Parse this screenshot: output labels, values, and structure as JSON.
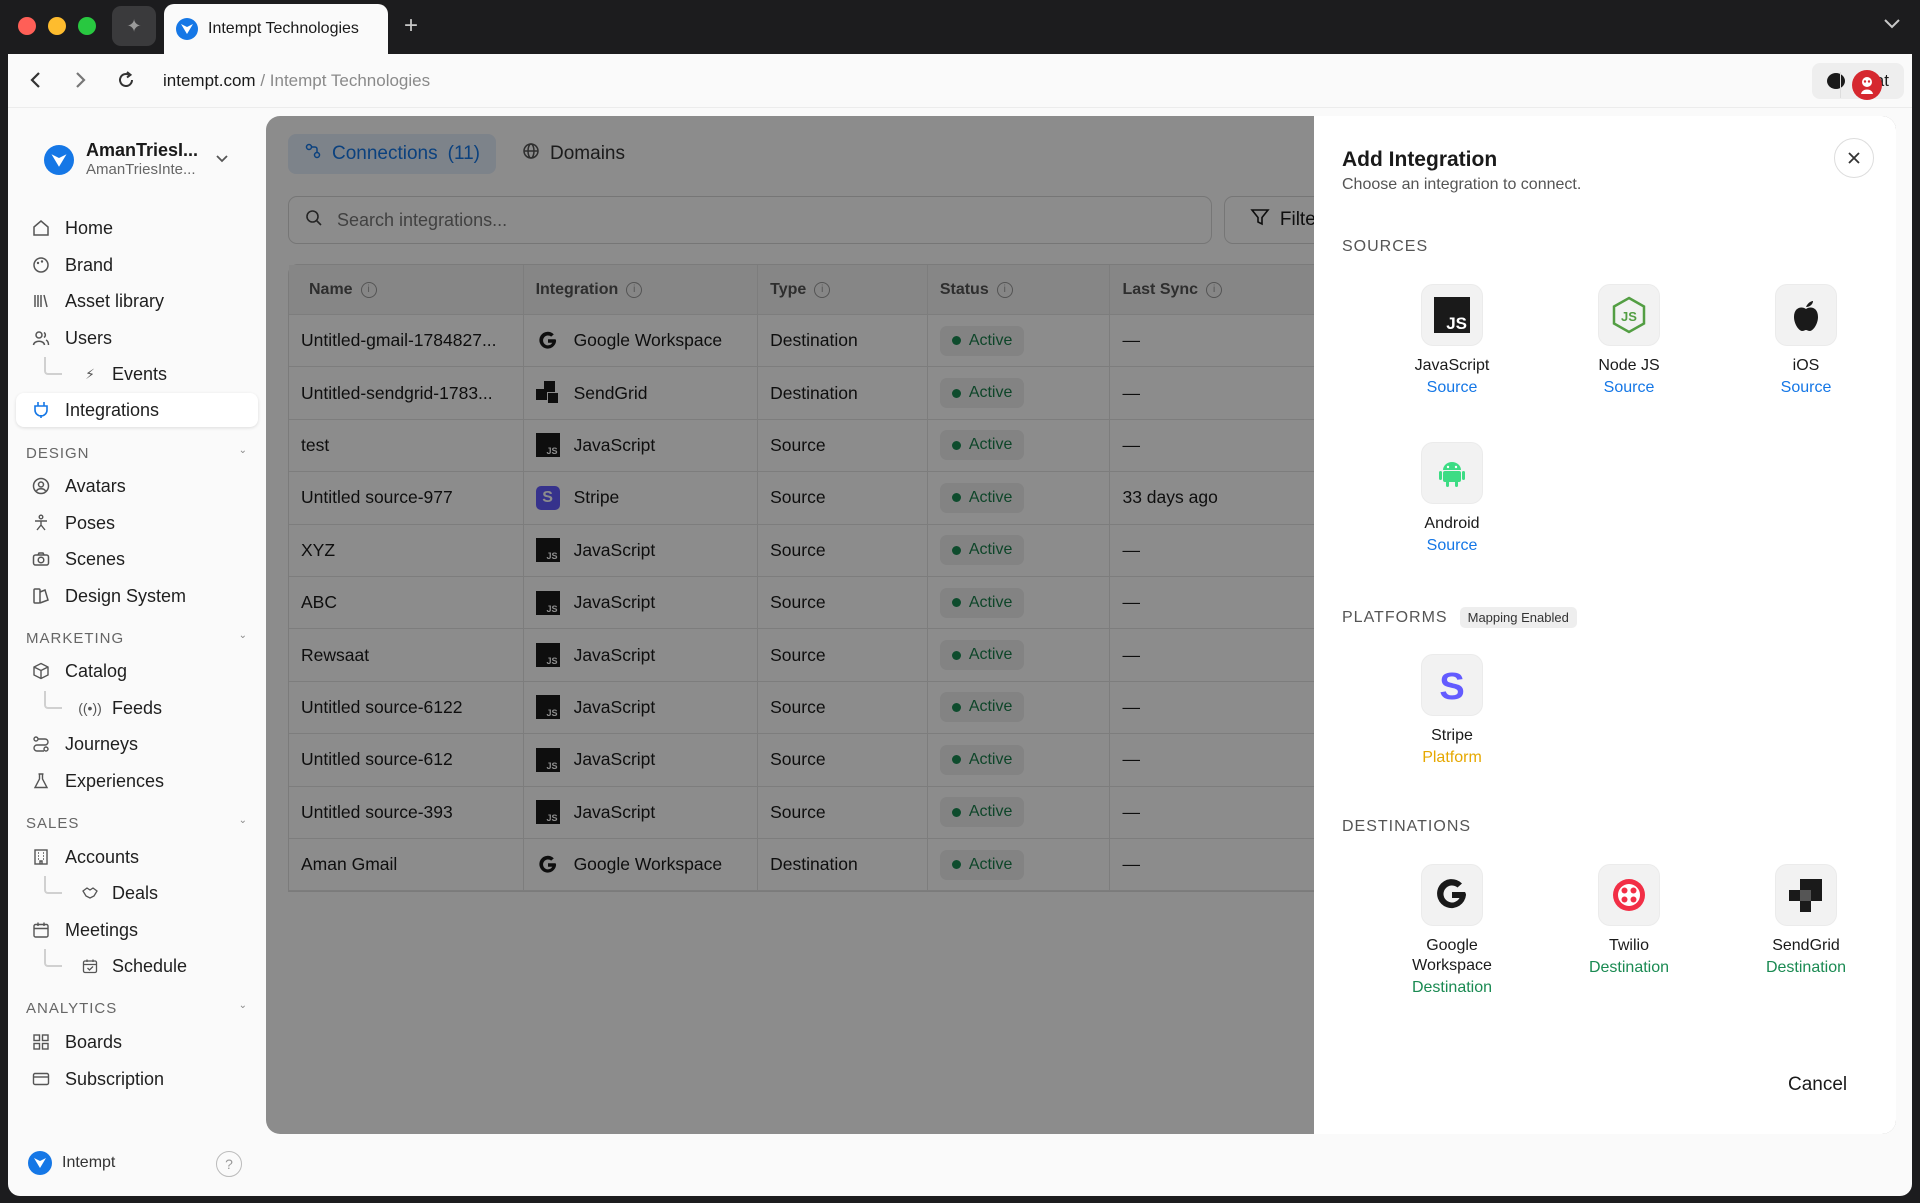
{
  "browser": {
    "tab_title": "Intempt Technologies",
    "url_domain": "intempt.com",
    "url_separator": " / ",
    "url_path": "Intempt Technologies",
    "chat_label": "Chat"
  },
  "workspace": {
    "name": "AmanTriesI...",
    "subtitle": "AmanTriesInte..."
  },
  "nav": {
    "home": "Home",
    "brand": "Brand",
    "asset_library": "Asset library",
    "users": "Users",
    "events": "Events",
    "integrations": "Integrations",
    "design_section": "DESIGN",
    "avatars": "Avatars",
    "poses": "Poses",
    "scenes": "Scenes",
    "design_system": "Design System",
    "marketing_section": "MARKETING",
    "catalog": "Catalog",
    "feeds": "Feeds",
    "journeys": "Journeys",
    "experiences": "Experiences",
    "sales_section": "SALES",
    "accounts": "Accounts",
    "deals": "Deals",
    "meetings": "Meetings",
    "schedule": "Schedule",
    "analytics_section": "ANALYTICS",
    "boards": "Boards",
    "subscription": "Subscription"
  },
  "footer": {
    "brand": "Intempt",
    "help": "?"
  },
  "main": {
    "tab_connections": "Connections",
    "tab_connections_count": "(11)",
    "tab_domains": "Domains",
    "search_placeholder": "Search integrations...",
    "filter_label": "Filter",
    "columns": {
      "name": "Name",
      "integration": "Integration",
      "type": "Type",
      "status": "Status",
      "last_sync": "Last Sync"
    },
    "rows": [
      {
        "name": "Untitled-gmail-1784827...",
        "integration": "Google Workspace",
        "logo": "google",
        "type": "Destination",
        "status": "Active",
        "last_sync": "—"
      },
      {
        "name": "Untitled-sendgrid-1783...",
        "integration": "SendGrid",
        "logo": "sendgrid",
        "type": "Destination",
        "status": "Active",
        "last_sync": "—"
      },
      {
        "name": "test",
        "integration": "JavaScript",
        "logo": "js",
        "type": "Source",
        "status": "Active",
        "last_sync": "—"
      },
      {
        "name": "Untitled source-977",
        "integration": "Stripe",
        "logo": "stripe",
        "type": "Source",
        "status": "Active",
        "last_sync": "33 days ago"
      },
      {
        "name": "XYZ",
        "integration": "JavaScript",
        "logo": "js",
        "type": "Source",
        "status": "Active",
        "last_sync": "—"
      },
      {
        "name": "ABC",
        "integration": "JavaScript",
        "logo": "js",
        "type": "Source",
        "status": "Active",
        "last_sync": "—"
      },
      {
        "name": "Rewsaat",
        "integration": "JavaScript",
        "logo": "js",
        "type": "Source",
        "status": "Active",
        "last_sync": "—"
      },
      {
        "name": "Untitled source-6122",
        "integration": "JavaScript",
        "logo": "js",
        "type": "Source",
        "status": "Active",
        "last_sync": "—"
      },
      {
        "name": "Untitled source-612",
        "integration": "JavaScript",
        "logo": "js",
        "type": "Source",
        "status": "Active",
        "last_sync": "—"
      },
      {
        "name": "Untitled source-393",
        "integration": "JavaScript",
        "logo": "js",
        "type": "Source",
        "status": "Active",
        "last_sync": "—"
      },
      {
        "name": "Aman Gmail",
        "integration": "Google Workspace",
        "logo": "google",
        "type": "Destination",
        "status": "Active",
        "last_sync": "—"
      }
    ]
  },
  "drawer": {
    "title": "Add Integration",
    "subtitle": "Choose an integration to connect.",
    "sources_label": "SOURCES",
    "platforms_label": "PLATFORMS",
    "platforms_badge": "Mapping Enabled",
    "destinations_label": "DESTINATIONS",
    "sources": [
      {
        "name": "JavaScript",
        "kind": "Source",
        "icon": "javascript-icon"
      },
      {
        "name": "Node JS",
        "kind": "Source",
        "icon": "nodejs-icon"
      },
      {
        "name": "iOS",
        "kind": "Source",
        "icon": "apple-icon"
      },
      {
        "name": "Android",
        "kind": "Source",
        "icon": "android-icon"
      }
    ],
    "platforms": [
      {
        "name": "Stripe",
        "kind": "Platform",
        "icon": "stripe-icon"
      }
    ],
    "destinations": [
      {
        "name": "Google Workspace",
        "kind": "Destination",
        "icon": "google-icon"
      },
      {
        "name": "Twilio",
        "kind": "Destination",
        "icon": "twilio-icon"
      },
      {
        "name": "SendGrid",
        "kind": "Destination",
        "icon": "sendgrid-icon"
      }
    ],
    "cancel_label": "Cancel"
  },
  "colors": {
    "accent": "#1577e6",
    "active_status": "#1a8a52",
    "platform": "#e6a800",
    "stripe": "#635bff",
    "twilio": "#f22f46"
  }
}
